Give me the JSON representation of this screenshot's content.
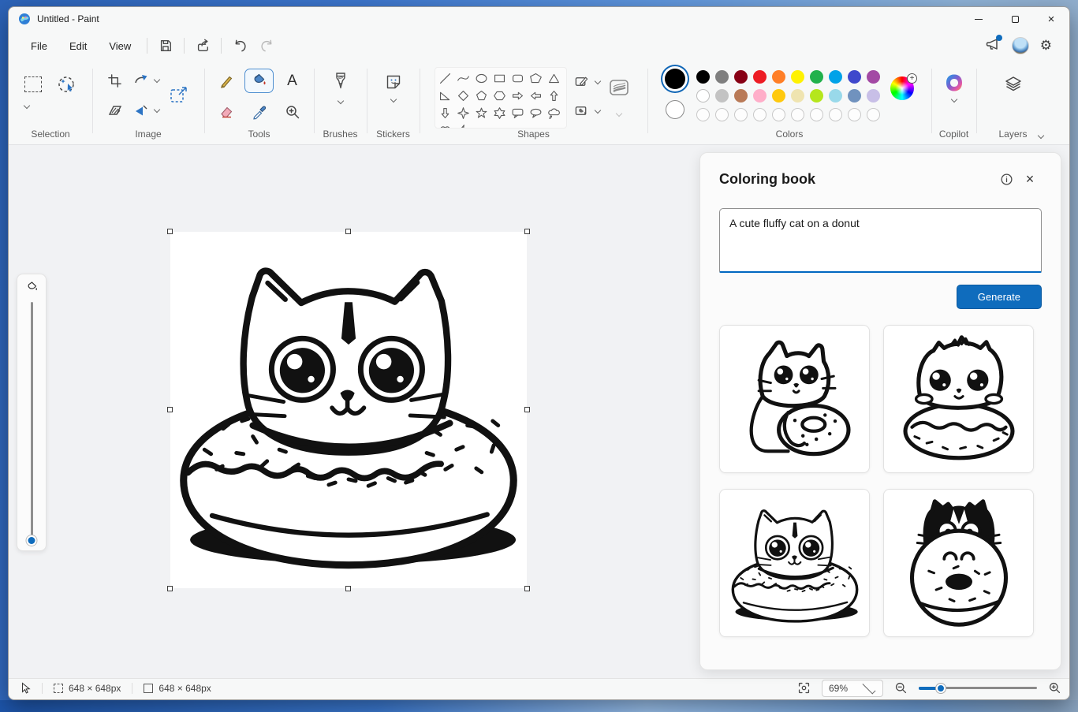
{
  "window": {
    "title": "Untitled - Paint"
  },
  "menu": {
    "items": [
      "File",
      "Edit",
      "View"
    ]
  },
  "quick_actions": {
    "icons": [
      "save",
      "share",
      "undo",
      "redo"
    ],
    "undo_enabled": true,
    "redo_enabled": false
  },
  "titlebar_icons": [
    "paint-app",
    "minimize",
    "maximize",
    "close"
  ],
  "top_right_icons": [
    "announcement-megaphone",
    "account-avatar",
    "settings-gear"
  ],
  "ribbon": {
    "groups": {
      "selection": {
        "label": "Selection",
        "icons": [
          "rect-select",
          "free-form-select"
        ]
      },
      "image": {
        "label": "Image",
        "icons": [
          "crop",
          "rotate",
          "resize",
          "flip",
          "resize-image"
        ]
      },
      "tools": {
        "label": "Tools",
        "icons": [
          "pencil",
          "fill",
          "text",
          "eraser",
          "color-picker",
          "magnifier"
        ],
        "selected_tool": "fill"
      },
      "brushes": {
        "label": "Brushes"
      },
      "stickers": {
        "label": "Stickers"
      },
      "shapes": {
        "label": "Shapes",
        "items": [
          "line",
          "curve",
          "ellipse",
          "rectangle",
          "rounded-rectangle",
          "polygon",
          "triangle",
          "right-triangle",
          "diamond",
          "pentagon",
          "hexagon",
          "arrow-right",
          "arrow-left",
          "arrow-up",
          "arrow-down",
          "star-4",
          "star-5",
          "star-6",
          "callout-rounded",
          "callout-oval",
          "callout-cloud",
          "heart",
          "lightning"
        ],
        "side_buttons": [
          "shape-outline",
          "shape-fill",
          "stroke-size"
        ]
      },
      "colors": {
        "label": "Colors",
        "color1": "#000000",
        "color2": "#ffffff",
        "palette_rows": [
          [
            "#000000",
            "#7f7f7f",
            "#880015",
            "#ed1c24",
            "#ff7f27",
            "#fff200",
            "#22b14c",
            "#00a2e8",
            "#3f48cc",
            "#a349a4"
          ],
          [
            "#ffffff",
            "#c3c3c3",
            "#b97a57",
            "#ffaec9",
            "#ffc90e",
            "#efe4b0",
            "#b5e61d",
            "#99d9ea",
            "#7092be",
            "#c8bfe7"
          ]
        ],
        "empty_slots": 10,
        "extra": "edit-colors-wheel"
      },
      "copilot": {
        "label": "Copilot"
      },
      "layers": {
        "label": "Layers"
      }
    }
  },
  "panel": {
    "title": "Coloring book",
    "header_icons": [
      "info",
      "close"
    ],
    "prompt_value": "A cute fluffy cat on a donut",
    "generate_label": "Generate",
    "thumbnails": [
      {
        "name": "cat-hugging-donut"
      },
      {
        "name": "fluffy-cat-on-donut"
      },
      {
        "name": "cat-head-in-donut"
      },
      {
        "name": "tuxedo-cat-behind-donut"
      }
    ]
  },
  "canvas": {
    "artwork": "cat-head-in-donut-line-art",
    "selected": true
  },
  "status_bar": {
    "selection_size": "648 × 648px",
    "canvas_size": "648 × 648px",
    "zoom_level": "69%",
    "icons": [
      "cursor",
      "selection-size",
      "canvas-size",
      "fit-to-screen",
      "zoom-out",
      "zoom-slider",
      "zoom-in"
    ]
  },
  "colors": {
    "accent": "#0f6cbd",
    "focus_underline": "#0067c0",
    "canvas_bg": "#ffffff",
    "workspace_bg": "#f1f2f4"
  }
}
